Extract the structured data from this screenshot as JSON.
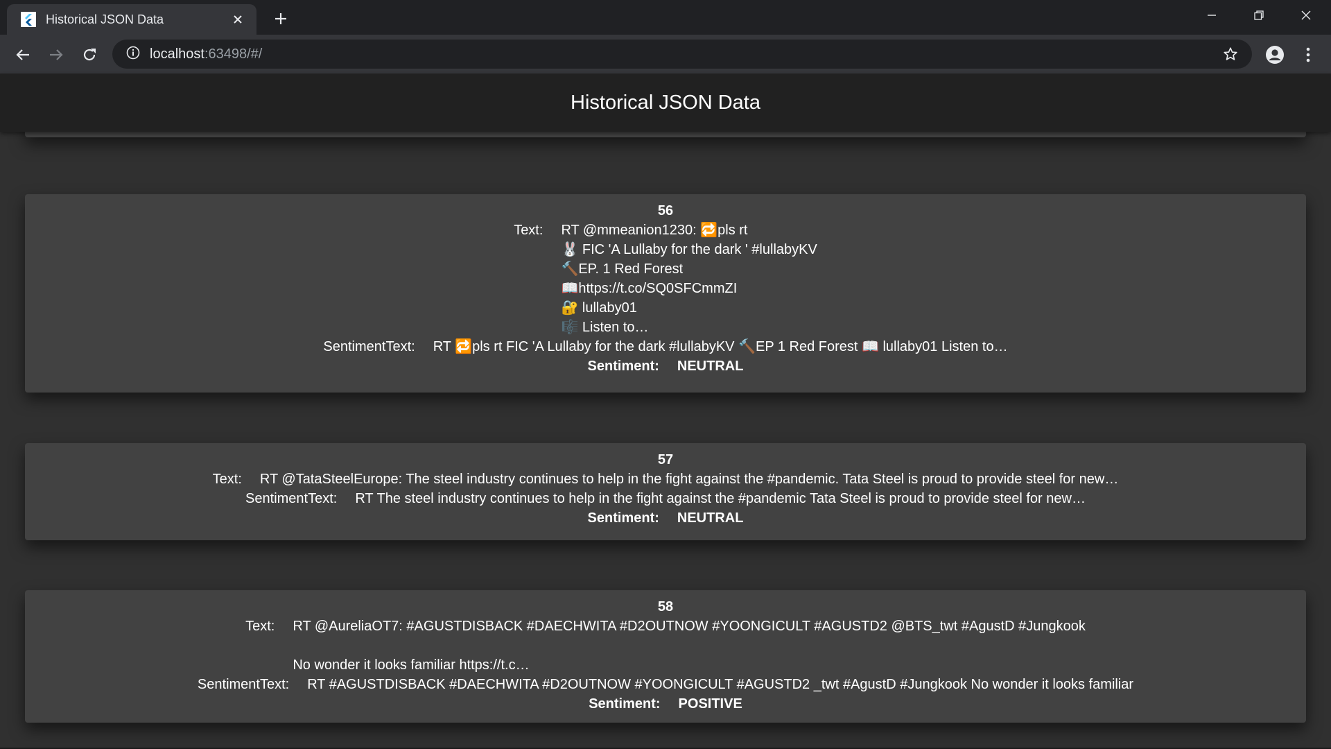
{
  "browser": {
    "tab_title": "Historical JSON Data",
    "url_host": "localhost",
    "url_rest": ":63498/#/"
  },
  "app": {
    "title": "Historical JSON Data"
  },
  "labels": {
    "text": "Text:",
    "sentiment_text": "SentimentText:",
    "sentiment": "Sentiment:"
  },
  "records": [
    {
      "id": "56",
      "text": "RT @mmeanion1230: 🔁pls rt\n🐰 FIC 'A Lullaby for the dark ' #lullabyKV\n🔨EP. 1 Red Forest\n📖https://t.co/SQ0SFCmmZI\n🔐 lullaby01\n🎼 Listen to…",
      "sentiment_text": "RT 🔁pls rt FIC 'A Lullaby for the dark #lullabyKV 🔨EP 1 Red Forest 📖 lullaby01 Listen to…",
      "sentiment": "NEUTRAL"
    },
    {
      "id": "57",
      "text": "RT @TataSteelEurope: The steel industry continues to help in the fight against the #pandemic. Tata Steel is proud to provide steel for new…",
      "sentiment_text": "RT The steel industry continues to help in the fight against the #pandemic Tata Steel is proud to provide steel for new…",
      "sentiment": "NEUTRAL"
    },
    {
      "id": "58",
      "text": "RT @AureliaOT7: #AGUSTDISBACK #DAECHWITA #D2OUTNOW #YOONGICULT #AGUSTD2 @BTS_twt #AgustD #Jungkook\n\nNo wonder it looks familiar https://t.c…",
      "sentiment_text": "RT #AGUSTDISBACK #DAECHWITA #D2OUTNOW #YOONGICULT #AGUSTD2 _twt #AgustD #Jungkook No wonder it looks familiar",
      "sentiment": "POSITIVE"
    }
  ]
}
